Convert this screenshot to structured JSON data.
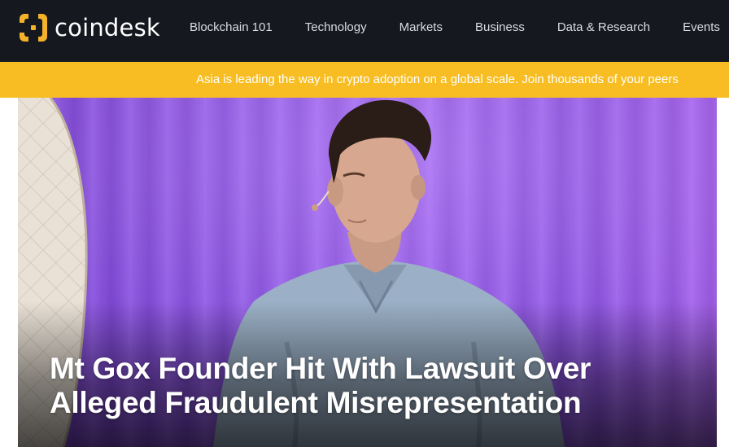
{
  "header": {
    "logo_text": "coindesk",
    "logo_icon": "coindesk-logo-icon",
    "nav": [
      {
        "label": "Blockchain 101"
      },
      {
        "label": "Technology"
      },
      {
        "label": "Markets"
      },
      {
        "label": "Business"
      },
      {
        "label": "Data & Research"
      },
      {
        "label": "Events"
      }
    ]
  },
  "banner": {
    "text": "Asia is leading the way in crypto adoption on a global scale. Join thousands of your peers"
  },
  "hero": {
    "headline": "Mt Gox Founder Hit With Lawsuit Over Alleged Fraudulent Misrepresentation"
  },
  "colors": {
    "nav_bg": "#15181f",
    "banner_bg": "#f7bd22",
    "logo_accent": "#f4b22b",
    "hero_purple": "#8c53e6"
  }
}
